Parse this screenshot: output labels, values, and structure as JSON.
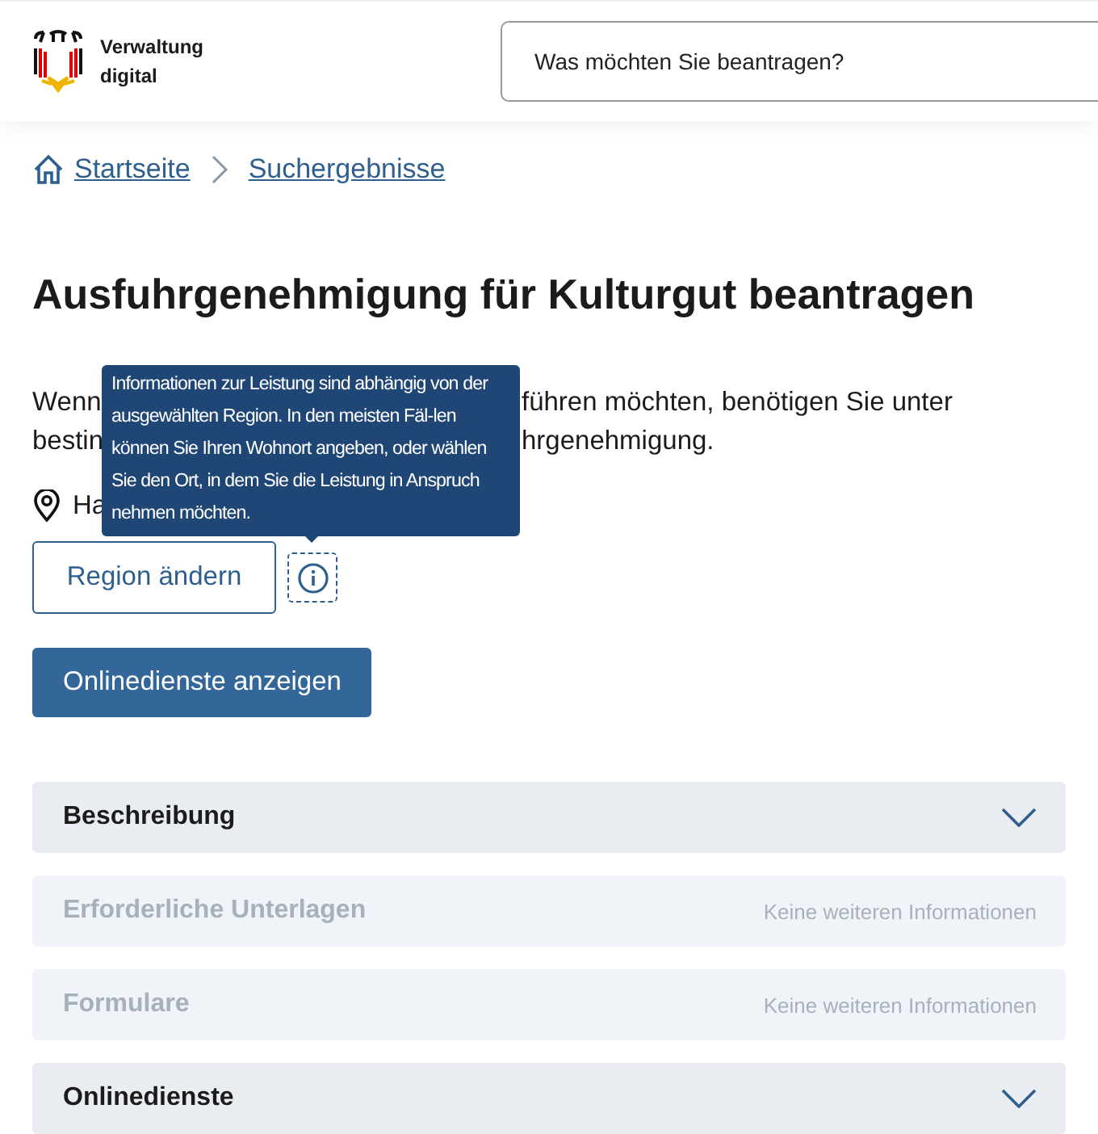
{
  "header": {
    "logo_text": [
      "Verwaltung",
      "digital"
    ],
    "search": {
      "placeholder": "Was möchten Sie beantragen?"
    }
  },
  "breadcrumb": [
    "Startseite",
    "Suchergebnisse"
  ],
  "title": "Ausfuhrgenehmigung für Kulturgut beantragen",
  "intro_lines": [
    {
      "start": "Wenn",
      "end": "führen möchten, benötigen Sie unter"
    },
    {
      "start": "bestin",
      "end": "hrgenehmigung."
    }
  ],
  "location": "Ha",
  "region_button": "Region ändern",
  "tooltip": "Informationen zur Leistung sind abhängig von der ausgewählten Region. In den meisten Fäl-len können Sie Ihren Wohnort angeben, oder wählen Sie den Ort, in dem Sie die Leistung in Anspruch nehmen möchten.",
  "online_button": "Onlinedienste anzeigen",
  "sections": [
    {
      "title": "Beschreibung",
      "disabled": false
    },
    {
      "title": "Erforderliche Unterlagen",
      "disabled": true,
      "note": "Keine weiteren Informationen"
    },
    {
      "title": "Formulare",
      "disabled": true,
      "note": "Keine weiteren Informationen"
    },
    {
      "title": "Onlinedienste",
      "disabled": false
    }
  ]
}
